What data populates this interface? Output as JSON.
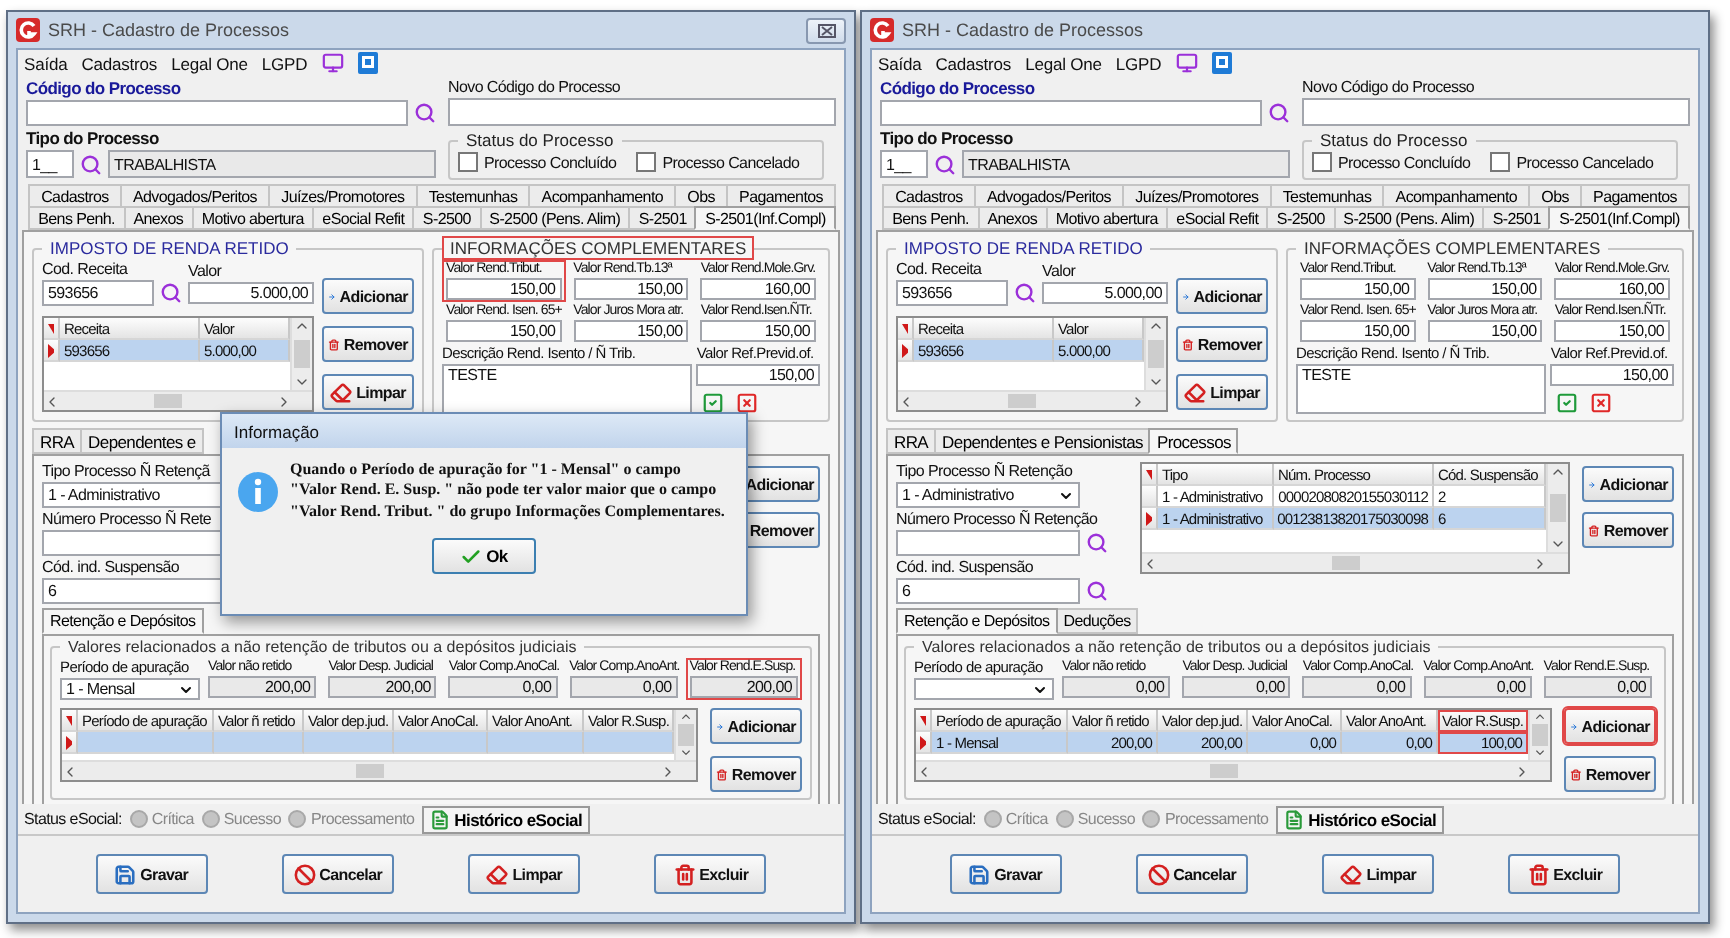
{
  "windows": [
    {
      "title": "SRH - Cadastro de Processos",
      "close_button": true,
      "menu": [
        "Saída",
        "Cadastros",
        "Legal One",
        "LGPD"
      ],
      "codigo": {
        "label": "Código do Processo"
      },
      "novo_codigo": {
        "label": "Novo Código do Processo"
      },
      "tipo": {
        "label": "Tipo do Processo",
        "code": "1__",
        "description": "TRABALHISTA"
      },
      "status": {
        "legend": "Status do Processo",
        "options": [
          {
            "label": "Processo Concluído",
            "checked": false
          },
          {
            "label": "Processo Cancelado",
            "checked": false
          }
        ]
      },
      "tab_rows": [
        [
          {
            "label": "Cadastros",
            "selected": false
          },
          {
            "label": "Advogados/Peritos",
            "selected": false
          },
          {
            "label": "Juízes/Promotores",
            "selected": false
          },
          {
            "label": "Testemunhas",
            "selected": false
          },
          {
            "label": "Acompanhamento",
            "selected": false
          },
          {
            "label": "Obs",
            "selected": false
          },
          {
            "label": "Pagamentos",
            "selected": false
          }
        ],
        [
          {
            "label": "Bens Penh.",
            "selected": false
          },
          {
            "label": "Anexos",
            "selected": false
          },
          {
            "label": "Motivo abertura",
            "selected": false
          },
          {
            "label": "eSocial Refit",
            "selected": false
          },
          {
            "label": "S-2500",
            "selected": false
          },
          {
            "label": "S-2500 (Pens. Alim)",
            "selected": false
          },
          {
            "label": "S-2501",
            "selected": false
          },
          {
            "label": "S-2501(Inf.Compl)",
            "selected": true
          }
        ]
      ],
      "imposto": {
        "legend": "IMPOSTO DE RENDA RETIDO",
        "cod_label": "Cod. Receita",
        "cod_value": "593656",
        "valor_label": "Valor",
        "valor_value": "5.000,00",
        "columns": [
          "Receita",
          "Valor"
        ],
        "rows": [
          {
            "cells": [
              "593656",
              "5.000,00"
            ],
            "selected": true
          }
        ],
        "buttons": [
          {
            "label": "Adicionar",
            "kind": "add"
          },
          {
            "label": "Remover",
            "kind": "remove"
          },
          {
            "label": "Limpar",
            "kind": "clear"
          }
        ]
      },
      "info": {
        "legend": "INFORMAÇÕES COMPLEMENTARES",
        "highlighted": true,
        "fields": [
          {
            "label": "Valor Rend.Tribut.",
            "value": "150,00",
            "highlighted": true
          },
          {
            "label": "Valor Rend.Tb.13ª",
            "value": "150,00",
            "highlighted": false
          },
          {
            "label": "Valor Rend.Mole.Grv.",
            "value": "160,00",
            "highlighted": false
          },
          {
            "label": "Valor Rend. Isen. 65+",
            "value": "150,00",
            "highlighted": false
          },
          {
            "label": "Valor Juros Mora atr.",
            "value": "150,00",
            "highlighted": false
          },
          {
            "label": "Valor Rend.Isen.ÑTr.",
            "value": "150,00",
            "highlighted": false
          }
        ],
        "descricao": {
          "label": "Descrição Rend. Isento / Ñ Trib.",
          "value": "TESTE"
        },
        "ref": {
          "label": "Valor Ref.Previd.of.",
          "value": "150,00"
        }
      },
      "sub_tabs": [
        {
          "label": "RRA",
          "selected": false
        },
        {
          "label": "Dependentes e",
          "selected": false
        }
      ],
      "processos": {
        "fields": [
          {
            "label": "Tipo Processo Ñ Retençã",
            "value": "1 - Administrativo",
            "kind": "text"
          },
          {
            "label": "Número Processo Ñ Rete",
            "kind": "text"
          },
          {
            "label": "Cód. ind. Suspensão",
            "value": "6",
            "kind": "text"
          }
        ],
        "buttons": [
          {
            "label": "Adicionar",
            "kind": "add"
          },
          {
            "label": "Remover",
            "kind": "remove"
          }
        ]
      },
      "inner_tabs": [
        {
          "label": "Retenção e Depósitos",
          "selected": true
        }
      ],
      "valores": {
        "legend": "Valores relacionados a não retenção de tributos ou a depósitos judiciais",
        "periodo": {
          "label": "Período de apuração",
          "value": "1 - Mensal"
        },
        "fields": [
          {
            "label": "Valor não retido",
            "value": "200,00",
            "highlighted": false
          },
          {
            "label": "Valor Desp. Judicial",
            "value": "200,00",
            "highlighted": false
          },
          {
            "label": "Valor Comp.AnoCal.",
            "value": "0,00",
            "highlighted": false
          },
          {
            "label": "Valor Comp.AnoAnt.",
            "value": "0,00",
            "highlighted": false
          },
          {
            "label": "Valor Rend.E.Susp.",
            "value": "200,00",
            "highlighted": true
          }
        ],
        "columns": [
          {
            "label": "Período de apuração",
            "highlighted": false
          },
          {
            "label": "Valor ñ retido",
            "highlighted": false
          },
          {
            "label": "Valor dep.jud.",
            "highlighted": false
          },
          {
            "label": "Valor AnoCal.",
            "highlighted": false
          },
          {
            "label": "Valor AnoAnt.",
            "highlighted": false
          },
          {
            "label": "Valor R.Susp.",
            "highlighted": false
          }
        ],
        "rows": [
          {
            "selected": true
          }
        ],
        "buttons": [
          {
            "label": "Adicionar",
            "kind": "add",
            "highlighted": false
          },
          {
            "label": "Remover",
            "kind": "remove",
            "highlighted": false
          }
        ]
      },
      "status_bar": {
        "label": "Status eSocial:",
        "items": [
          {
            "label": "Crítica",
            "disabled": true
          },
          {
            "label": "Sucesso",
            "disabled": true
          },
          {
            "label": "Processamento",
            "disabled": true
          }
        ],
        "history_button": "Histórico eSocial"
      },
      "actions": [
        {
          "label": "Gravar",
          "kind": "save"
        },
        {
          "label": "Cancelar",
          "kind": "cancel"
        },
        {
          "label": "Limpar",
          "kind": "clear"
        },
        {
          "label": "Excluir",
          "kind": "delete"
        }
      ],
      "dialog": {
        "title": "Informação",
        "message": "Quando o Período de apuração for \"1 - Mensal\" o campo \"Valor Rend. E. Susp. \" não pode ter valor maior que o campo \"Valor Rend. Tribut. \" do grupo Informações Complementares.",
        "button": "Ok"
      }
    },
    {
      "title": "SRH - Cadastro de Processos",
      "close_button": false,
      "menu": [
        "Saída",
        "Cadastros",
        "Legal One",
        "LGPD"
      ],
      "codigo": {
        "label": "Código do Processo"
      },
      "novo_codigo": {
        "label": "Novo Código do Processo"
      },
      "tipo": {
        "label": "Tipo do Processo",
        "code": "1__",
        "description": "TRABALHISTA"
      },
      "status": {
        "legend": "Status do Processo",
        "options": [
          {
            "label": "Processo Concluído",
            "checked": false
          },
          {
            "label": "Processo Cancelado",
            "checked": false
          }
        ]
      },
      "tab_rows": [
        [
          {
            "label": "Cadastros",
            "selected": false
          },
          {
            "label": "Advogados/Peritos",
            "selected": false
          },
          {
            "label": "Juízes/Promotores",
            "selected": false
          },
          {
            "label": "Testemunhas",
            "selected": false
          },
          {
            "label": "Acompanhamento",
            "selected": false
          },
          {
            "label": "Obs",
            "selected": false
          },
          {
            "label": "Pagamentos",
            "selected": false
          }
        ],
        [
          {
            "label": "Bens Penh.",
            "selected": false
          },
          {
            "label": "Anexos",
            "selected": false
          },
          {
            "label": "Motivo abertura",
            "selected": false
          },
          {
            "label": "eSocial Refit",
            "selected": false
          },
          {
            "label": "S-2500",
            "selected": false
          },
          {
            "label": "S-2500 (Pens. Alim)",
            "selected": false
          },
          {
            "label": "S-2501",
            "selected": false
          },
          {
            "label": "S-2501(Inf.Compl)",
            "selected": true
          }
        ]
      ],
      "imposto": {
        "legend": "IMPOSTO DE RENDA RETIDO",
        "cod_label": "Cod. Receita",
        "cod_value": "593656",
        "valor_label": "Valor",
        "valor_value": "5.000,00",
        "columns": [
          "Receita",
          "Valor"
        ],
        "rows": [
          {
            "cells": [
              "593656",
              "5.000,00"
            ],
            "selected": true
          }
        ],
        "buttons": [
          {
            "label": "Adicionar",
            "kind": "add"
          },
          {
            "label": "Remover",
            "kind": "remove"
          },
          {
            "label": "Limpar",
            "kind": "clear"
          }
        ]
      },
      "info": {
        "legend": "INFORMAÇÕES COMPLEMENTARES",
        "highlighted": false,
        "fields": [
          {
            "label": "Valor Rend.Tribut.",
            "value": "150,00",
            "highlighted": false
          },
          {
            "label": "Valor Rend.Tb.13ª",
            "value": "150,00",
            "highlighted": false
          },
          {
            "label": "Valor Rend.Mole.Grv.",
            "value": "160,00",
            "highlighted": false
          },
          {
            "label": "Valor Rend. Isen. 65+",
            "value": "150,00",
            "highlighted": false
          },
          {
            "label": "Valor Juros Mora atr.",
            "value": "150,00",
            "highlighted": false
          },
          {
            "label": "Valor Rend.Isen.ÑTr.",
            "value": "150,00",
            "highlighted": false
          }
        ],
        "descricao": {
          "label": "Descrição Rend. Isento / Ñ Trib.",
          "value": "TESTE"
        },
        "ref": {
          "label": "Valor Ref.Previd.of.",
          "value": "150,00"
        }
      },
      "sub_tabs": [
        {
          "label": "RRA",
          "selected": false
        },
        {
          "label": "Dependentes e Pensionistas",
          "selected": false
        },
        {
          "label": "Processos",
          "selected": true
        }
      ],
      "processos": {
        "fields": [
          {
            "label": "Tipo Processo Ñ Retenção",
            "value": "1 - Administrativo",
            "kind": "select"
          },
          {
            "label": "Número Processo Ñ Retenção",
            "kind": "search"
          },
          {
            "label": "Cód. ind. Suspensão",
            "value": "6",
            "kind": "search"
          }
        ],
        "columns": [
          "Tipo",
          "Núm. Processo",
          "Cód. Suspensão"
        ],
        "rows": [
          {
            "cells": [
              "1 - Administrativo",
              "00002080820155030112",
              "2"
            ],
            "selected": false
          },
          {
            "cells": [
              "1 - Administrativo",
              "00123813820175030098",
              "6"
            ],
            "selected": true
          }
        ],
        "buttons": [
          {
            "label": "Adicionar",
            "kind": "add"
          },
          {
            "label": "Remover",
            "kind": "remove"
          }
        ]
      },
      "inner_tabs": [
        {
          "label": "Retenção e Depósitos",
          "selected": true
        },
        {
          "label": "Deduções",
          "selected": false
        }
      ],
      "valores": {
        "legend": "Valores relacionados a não retenção de tributos ou a depósitos judiciais",
        "periodo": {
          "label": "Período de apuração"
        },
        "fields": [
          {
            "label": "Valor não retido",
            "value": "0,00",
            "highlighted": false
          },
          {
            "label": "Valor Desp. Judicial",
            "value": "0,00",
            "highlighted": false
          },
          {
            "label": "Valor Comp.AnoCal.",
            "value": "0,00",
            "highlighted": false
          },
          {
            "label": "Valor Comp.AnoAnt.",
            "value": "0,00",
            "highlighted": false
          },
          {
            "label": "Valor Rend.E.Susp.",
            "value": "0,00",
            "highlighted": false
          }
        ],
        "columns": [
          {
            "label": "Período de apuração",
            "highlighted": false
          },
          {
            "label": "Valor ñ retido",
            "highlighted": false
          },
          {
            "label": "Valor dep.jud.",
            "highlighted": false
          },
          {
            "label": "Valor AnoCal.",
            "highlighted": false
          },
          {
            "label": "Valor AnoAnt.",
            "highlighted": false
          },
          {
            "label": "Valor R.Susp.",
            "highlighted": true
          }
        ],
        "rows": [
          {
            "cells": [
              "1 - Mensal",
              "200,00",
              "200,00",
              "0,00",
              "0,00",
              "100,00"
            ],
            "selected": true
          }
        ],
        "buttons": [
          {
            "label": "Adicionar",
            "kind": "add",
            "highlighted": true
          },
          {
            "label": "Remover",
            "kind": "remove",
            "highlighted": false
          }
        ]
      },
      "status_bar": {
        "label": "Status eSocial:",
        "items": [
          {
            "label": "Crítica",
            "disabled": true
          },
          {
            "label": "Sucesso",
            "disabled": true
          },
          {
            "label": "Processamento",
            "disabled": true
          }
        ],
        "history_button": "Histórico eSocial"
      },
      "actions": [
        {
          "label": "Gravar",
          "kind": "save"
        },
        {
          "label": "Cancelar",
          "kind": "cancel"
        },
        {
          "label": "Limpar",
          "kind": "clear"
        },
        {
          "label": "Excluir",
          "kind": "delete"
        }
      ]
    }
  ]
}
